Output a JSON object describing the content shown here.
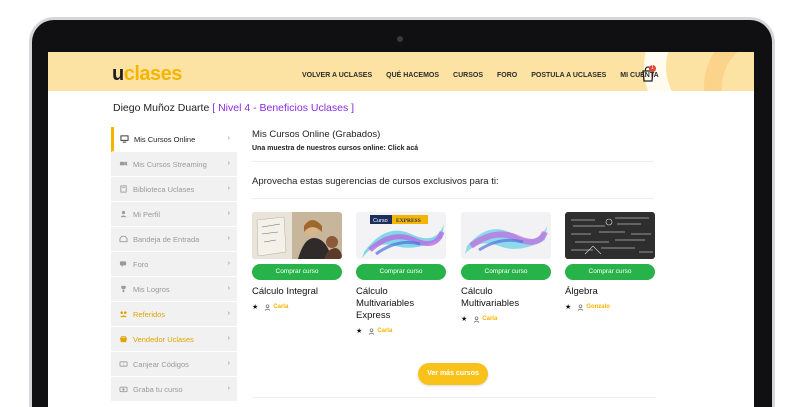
{
  "header": {
    "logo_u": "u",
    "logo_text": "clases",
    "nav": [
      "VOLVER A UCLASES",
      "QUÉ HACEMOS",
      "CURSOS",
      "FORO",
      "POSTULA A UCLASES",
      "MI CUENTA"
    ],
    "cart_count": "1"
  },
  "title": {
    "name": "Diego Muñoz Duarte",
    "level": "[ Nivel 4 - Beneficios Uclases ]"
  },
  "sidebar": {
    "items": [
      {
        "label": "Mis Cursos Online",
        "icon": "monitor-icon",
        "state": "active"
      },
      {
        "label": "Mis Cursos Streaming",
        "icon": "video-icon",
        "state": "muted"
      },
      {
        "label": "Biblioteca Uclases",
        "icon": "book-icon",
        "state": "muted"
      },
      {
        "label": "Mi Perfil",
        "icon": "user-icon",
        "state": "muted"
      },
      {
        "label": "Bandeja de Entrada",
        "icon": "inbox-icon",
        "state": "muted"
      },
      {
        "label": "Foro",
        "icon": "forum-icon",
        "state": "muted"
      },
      {
        "label": "Mis Logros",
        "icon": "trophy-icon",
        "state": "muted"
      },
      {
        "label": "Referidos",
        "icon": "referral-icon",
        "state": "gold"
      },
      {
        "label": "Vendedor Uclases",
        "icon": "seller-icon",
        "state": "gold"
      },
      {
        "label": "Canjear Códigos",
        "icon": "ticket-icon",
        "state": "muted"
      },
      {
        "label": "Graba tu curso",
        "icon": "camera-icon",
        "state": "muted"
      }
    ]
  },
  "main": {
    "heading": "Mis Cursos Online (Grabados)",
    "subtext": "Una muestra de nuestros cursos online: Click acá",
    "suggest": "Aprovecha estas sugerencias de cursos exclusivos para ti:",
    "more_button": "Ver más cursos"
  },
  "cards": [
    {
      "title": "Cálculo Integral",
      "button": "Comprar curso",
      "author": "Carla",
      "thumb": "teacher"
    },
    {
      "title": "Cálculo Multivariables Express",
      "button": "Comprar curso",
      "author": "Carla",
      "thumb": "express",
      "badge_curso": "Curso",
      "badge_express": "EXPRESS"
    },
    {
      "title": "Cálculo Multivariables",
      "button": "Comprar curso",
      "author": "Carla",
      "thumb": "surface"
    },
    {
      "title": "Álgebra",
      "button": "Comprar curso",
      "author": "Gonzalo",
      "thumb": "blackboard"
    }
  ],
  "colors": {
    "header_bg": "#fde3a3",
    "brand": "#f5b400",
    "level": "#8a2be2",
    "buy": "#27b24a",
    "more": "#f8c21b"
  }
}
